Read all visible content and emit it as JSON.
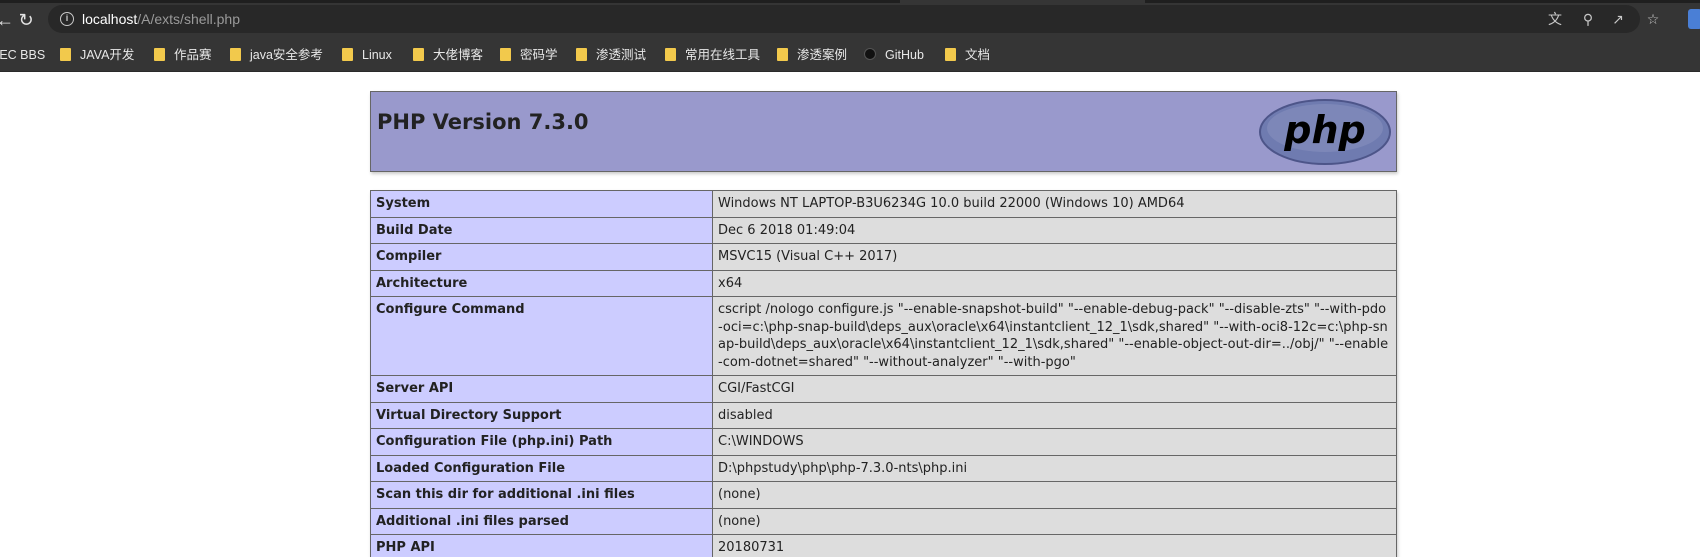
{
  "browser": {
    "url_host": "localhost",
    "url_path": "/A/exts/shell.php",
    "bookmarks": [
      {
        "label": "SEC BBS",
        "type": "link"
      },
      {
        "label": "JAVA开发",
        "type": "folder"
      },
      {
        "label": "作品赛",
        "type": "folder"
      },
      {
        "label": "java安全参考",
        "type": "folder"
      },
      {
        "label": "Linux",
        "type": "folder"
      },
      {
        "label": "大佬博客",
        "type": "folder"
      },
      {
        "label": "密码学",
        "type": "folder"
      },
      {
        "label": "渗透测试",
        "type": "folder"
      },
      {
        "label": "常用在线工具",
        "type": "folder"
      },
      {
        "label": "渗透案例",
        "type": "folder"
      },
      {
        "label": "GitHub",
        "type": "link"
      },
      {
        "label": "文档",
        "type": "folder"
      }
    ]
  },
  "phpinfo": {
    "title": "PHP Version 7.3.0",
    "logo_text": "php",
    "rows": [
      {
        "key": "System",
        "value": "Windows NT LAPTOP-B3U6234G 10.0 build 22000 (Windows 10) AMD64"
      },
      {
        "key": "Build Date",
        "value": "Dec 6 2018 01:49:04"
      },
      {
        "key": "Compiler",
        "value": "MSVC15 (Visual C++ 2017)"
      },
      {
        "key": "Architecture",
        "value": "x64"
      },
      {
        "key": "Configure Command",
        "value": "cscript /nologo configure.js \"--enable-snapshot-build\" \"--enable-debug-pack\" \"--disable-zts\" \"--with-pdo-oci=c:\\php-snap-build\\deps_aux\\oracle\\x64\\instantclient_12_1\\sdk,shared\" \"--with-oci8-12c=c:\\php-snap-build\\deps_aux\\oracle\\x64\\instantclient_12_1\\sdk,shared\" \"--enable-object-out-dir=../obj/\" \"--enable-com-dotnet=shared\" \"--without-analyzer\" \"--with-pgo\""
      },
      {
        "key": "Server API",
        "value": "CGI/FastCGI"
      },
      {
        "key": "Virtual Directory Support",
        "value": "disabled"
      },
      {
        "key": "Configuration File (php.ini) Path",
        "value": "C:\\WINDOWS"
      },
      {
        "key": "Loaded Configuration File",
        "value": "D:\\phpstudy\\php\\php-7.3.0-nts\\php.ini"
      },
      {
        "key": "Scan this dir for additional .ini files",
        "value": "(none)"
      },
      {
        "key": "Additional .ini files parsed",
        "value": "(none)"
      },
      {
        "key": "PHP API",
        "value": "20180731"
      }
    ]
  }
}
